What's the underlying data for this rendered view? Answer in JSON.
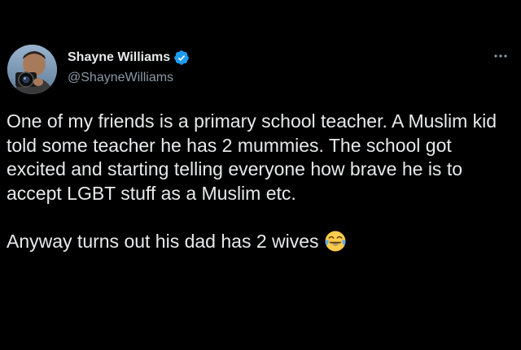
{
  "author": {
    "display_name": "Shayne Williams",
    "handle": "@ShayneWilliams",
    "verified": true
  },
  "icons": {
    "verified": "verified-badge-icon",
    "more": "more-options-icon",
    "emoji": "face-with-tears-of-joy-emoji"
  },
  "tweet": {
    "paragraph_1": "One of my friends is a primary school teacher. A Muslim kid told some teacher he has 2 mummies. The school got excited and starting telling everyone how brave he is to accept LGBT stuff as a Muslim etc.",
    "paragraph_2": "Anyway turns out his dad has 2 wives"
  },
  "colors": {
    "background": "#000000",
    "text_primary": "#e7e9ea",
    "text_secondary": "#8b98a5",
    "verified_blue": "#1d9bf0"
  }
}
